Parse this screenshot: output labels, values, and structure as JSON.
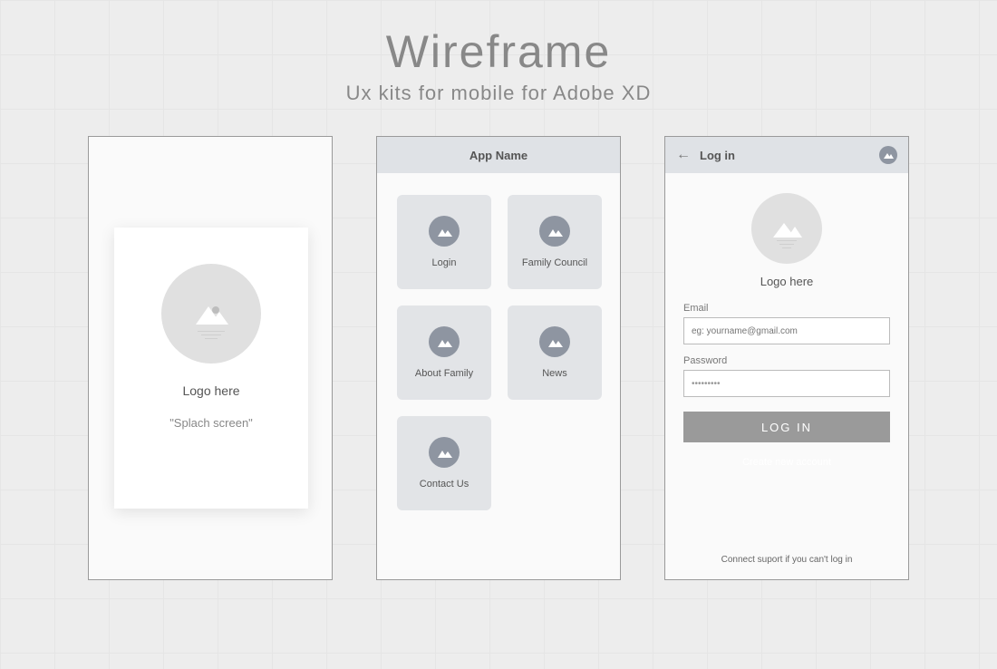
{
  "page": {
    "title": "Wireframe",
    "subtitle": "Ux kits for mobile for Adobe XD"
  },
  "splash": {
    "logo_label": "Logo here",
    "screen_label": "\"Splach screen\""
  },
  "menu": {
    "appbar_title": "App Name",
    "tiles": [
      {
        "label": "Login"
      },
      {
        "label": "Family Council"
      },
      {
        "label": "About Family"
      },
      {
        "label": "News"
      },
      {
        "label": "Contact Us"
      }
    ]
  },
  "login": {
    "appbar_title": "Log in",
    "logo_label": "Logo here",
    "email_label": "Email",
    "email_placeholder": "eg: yourname@gmail.com",
    "password_label": "Password",
    "password_value": "•••••••••",
    "login_button": "LOG IN",
    "create_link": "Create new account",
    "support_text": "Connect suport if you can't log in"
  }
}
